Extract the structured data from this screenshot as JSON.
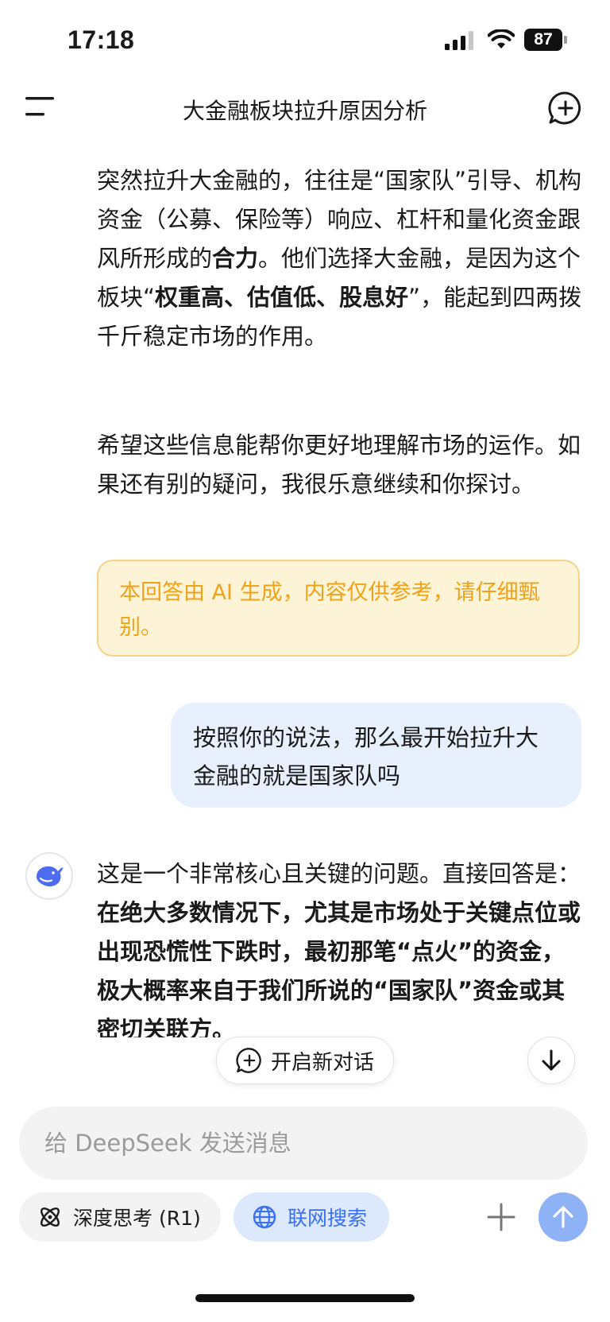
{
  "status": {
    "time": "17:18",
    "battery": "87"
  },
  "nav": {
    "title": "大金融板块拉升原因分析"
  },
  "answer_top": {
    "p1": [
      {
        "text": "突然拉升大金融的，往往是“国家队”引导、机构资金（公募、保险等）响应、杠杆和量化资金跟风所形成的",
        "bold": false
      },
      {
        "text": "合力",
        "bold": true
      },
      {
        "text": "。他们选择大金融，是因为这个板块“",
        "bold": false
      },
      {
        "text": "权重高、估值低、股息好",
        "bold": true
      },
      {
        "text": "”，能起到四两拨千斤稳定市场的作用。",
        "bold": false
      }
    ],
    "p2": "希望这些信息能帮你更好地理解市场的运作。如果还有别的疑问，我很乐意继续和你探讨。"
  },
  "notice": "本回答由 AI 生成，内容仅供参考，请仔细甄别。",
  "user_message": "按照你的说法，那么最开始拉升大金融的就是国家队吗",
  "answer_bottom": {
    "p3": [
      {
        "text": "这是一个非常核心且关键的问题。直接回答是：",
        "bold": false
      },
      {
        "text": "在绝大多数情况下，尤其是市场处于关键点位或出现恐慌性下跌时，最初那笔“点火”的资金，极大概率来自于我们所说的“国家队”资金或其密切关联方。",
        "bold": true
      }
    ]
  },
  "floating": {
    "new_chat": "开启新对话"
  },
  "input": {
    "placeholder": "给 DeepSeek 发送消息"
  },
  "chips": {
    "deep_think": "深度思考 (R1)",
    "web_search": "联网搜索"
  },
  "colors": {
    "accent": "#3b6ff5",
    "send_button": "#8fb1f6",
    "notice_text": "#f0a21a",
    "user_bubble": "#e8f0fd"
  }
}
